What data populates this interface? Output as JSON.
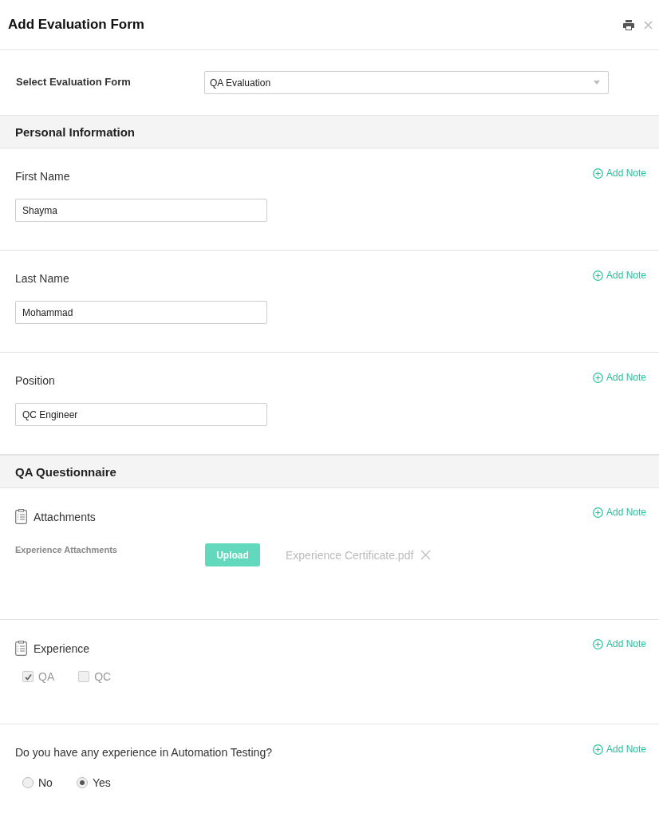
{
  "title": "Add Evaluation Form",
  "select": {
    "label": "Select Evaluation Form",
    "value": "QA Evaluation"
  },
  "sections": [
    {
      "title": "Personal Information",
      "items": [
        {
          "kind": "text",
          "label": "First Name",
          "value": "Shayma",
          "note": "Add Note"
        },
        {
          "kind": "text",
          "label": "Last Name",
          "value": "Mohammad",
          "note": "Add Note"
        },
        {
          "kind": "text",
          "label": "Position",
          "value": "QC Engineer",
          "note": "Add Note"
        }
      ]
    },
    {
      "title": "QA Questionnaire",
      "items": [
        {
          "kind": "attachment",
          "label": "Attachments",
          "note": "Add Note",
          "field_label": "Experience Attachments",
          "button": "Upload",
          "file": "Experience Certificate.pdf"
        },
        {
          "kind": "checkboxes",
          "label": "Experience",
          "note": "Add Note",
          "options": [
            {
              "label": "QA",
              "checked": true
            },
            {
              "label": "QC",
              "checked": false
            }
          ]
        },
        {
          "kind": "radios",
          "label": "Do you have any experience in Automation Testing?",
          "note": "Add Note",
          "options": [
            {
              "label": "No",
              "selected": false
            },
            {
              "label": "Yes",
              "selected": true
            }
          ]
        }
      ]
    }
  ]
}
